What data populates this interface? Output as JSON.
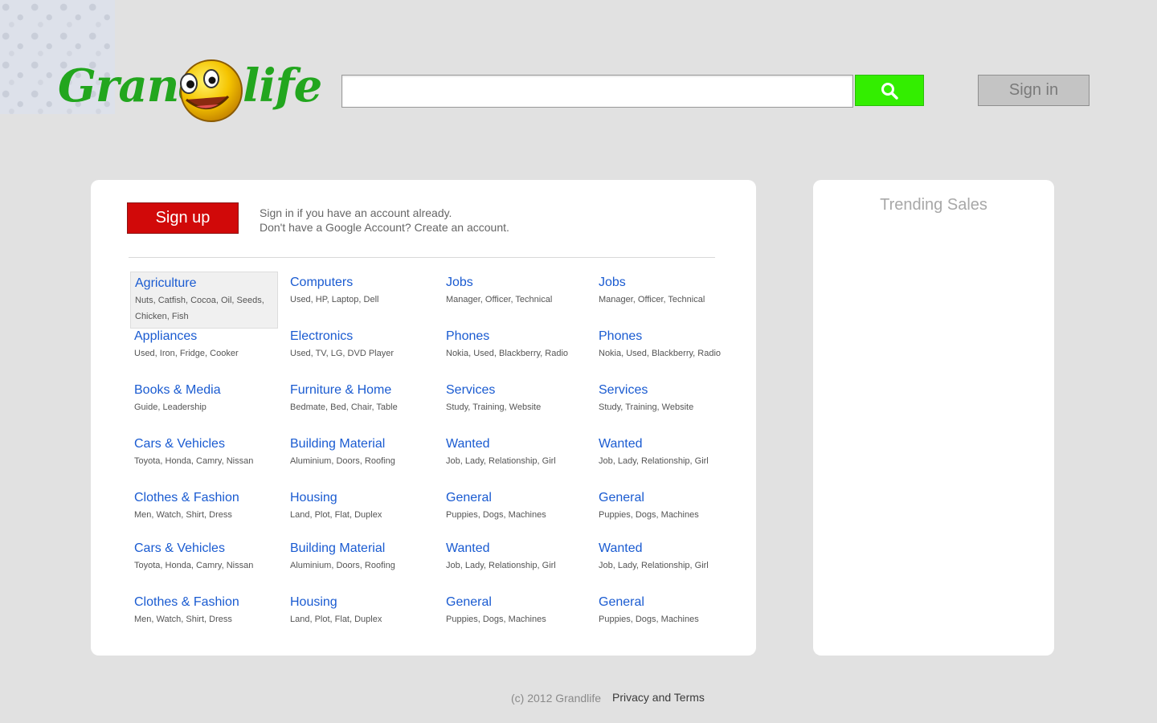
{
  "colors": {
    "background": "#e1e1e1",
    "brand_green": "#22a61e",
    "search_green": "#33ee00",
    "signup_red": "#d10909",
    "link_blue": "#1a5bd1"
  },
  "logo": {
    "word1": "Grand",
    "word2": "life",
    "mascot_icon": "smiley-face-icon"
  },
  "search": {
    "placeholder": "",
    "value": "",
    "button_icon": "search-icon"
  },
  "header": {
    "signin_label": "Sign in"
  },
  "panel": {
    "signup_label": "Sign up",
    "info_line1": "Sign in if you have an account already.",
    "info_line2": "Don't have a Google Account? Create an account."
  },
  "categories": [
    {
      "title": "Agriculture",
      "tags": "Nuts, Catfish, Cocoa, Oil, Seeds, Chicken, Fish"
    },
    {
      "title": "Computers",
      "tags": "Used, HP, Laptop, Dell"
    },
    {
      "title": "Jobs",
      "tags": "Manager, Officer, Technical"
    },
    {
      "title": "Jobs",
      "tags": "Manager, Officer, Technical"
    },
    {
      "title": "Appliances",
      "tags": "Used, Iron, Fridge, Cooker"
    },
    {
      "title": "Electronics",
      "tags": "Used, TV, LG, DVD Player"
    },
    {
      "title": "Phones",
      "tags": "Nokia, Used, Blackberry, Radio"
    },
    {
      "title": "Phones",
      "tags": "Nokia, Used, Blackberry, Radio"
    },
    {
      "title": "Books & Media",
      "tags": "Guide, Leadership"
    },
    {
      "title": "Furniture & Home",
      "tags": "Bedmate, Bed, Chair, Table"
    },
    {
      "title": "Services",
      "tags": "Study, Training, Website"
    },
    {
      "title": "Services",
      "tags": "Study, Training, Website"
    },
    {
      "title": "Cars & Vehicles",
      "tags": "Toyota, Honda, Camry, Nissan"
    },
    {
      "title": "Building Material",
      "tags": "Aluminium, Doors, Roofing"
    },
    {
      "title": "Wanted",
      "tags": "Job, Lady, Relationship, Girl"
    },
    {
      "title": "Wanted",
      "tags": "Job, Lady, Relationship, Girl"
    },
    {
      "title": "Clothes & Fashion",
      "tags": "Men, Watch, Shirt, Dress"
    },
    {
      "title": "Housing",
      "tags": "Land, Plot, Flat, Duplex"
    },
    {
      "title": "General",
      "tags": "Puppies, Dogs, Machines"
    },
    {
      "title": "General",
      "tags": "Puppies, Dogs, Machines"
    },
    {
      "title": "Cars & Vehicles",
      "tags": "Toyota, Honda, Camry, Nissan"
    },
    {
      "title": "Building Material",
      "tags": "Aluminium, Doors, Roofing"
    },
    {
      "title": "Wanted",
      "tags": "Job, Lady, Relationship, Girl"
    },
    {
      "title": "Wanted",
      "tags": "Job, Lady, Relationship, Girl"
    },
    {
      "title": "Clothes & Fashion",
      "tags": "Men, Watch, Shirt, Dress"
    },
    {
      "title": "Housing",
      "tags": "Land, Plot, Flat, Duplex"
    },
    {
      "title": "General",
      "tags": "Puppies, Dogs, Machines"
    },
    {
      "title": "General",
      "tags": "Puppies, Dogs, Machines"
    }
  ],
  "sidebar": {
    "title": "Trending Sales"
  },
  "footer": {
    "copyright": "(c) 2012 Grandlife",
    "privacy_link": "Privacy and Terms"
  }
}
